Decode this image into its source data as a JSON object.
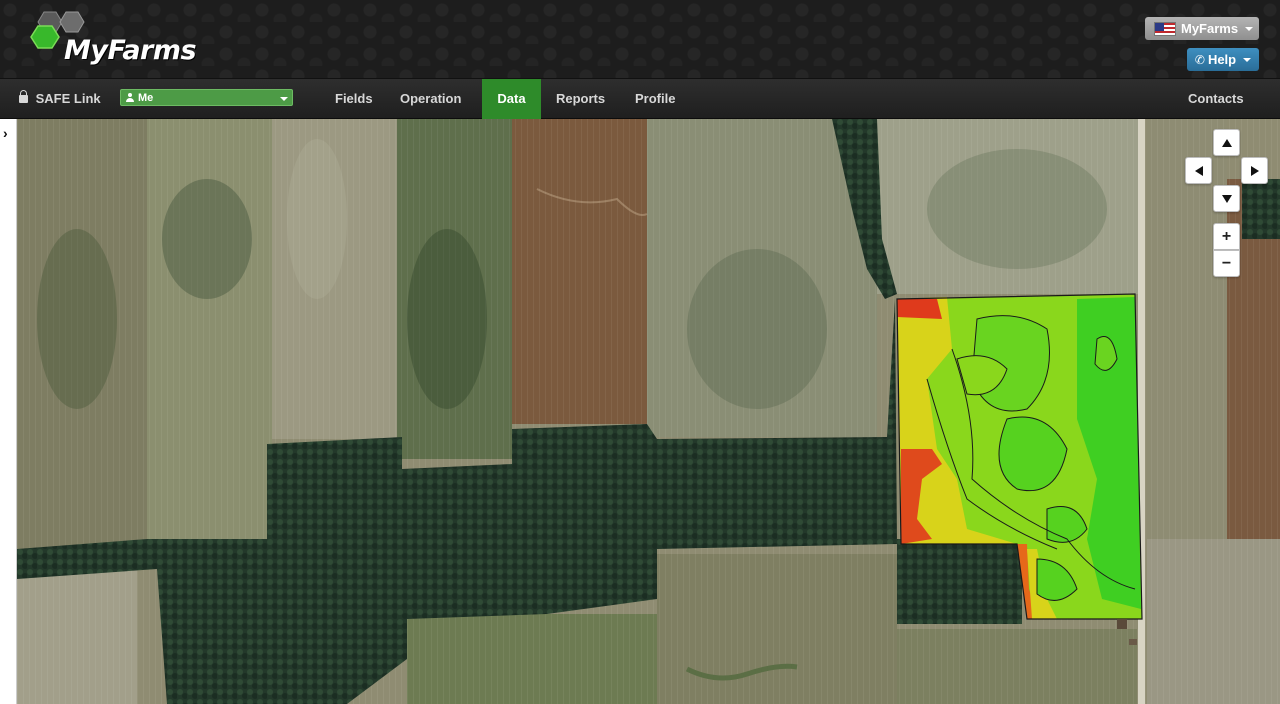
{
  "app": {
    "brand": "MyFarms"
  },
  "header": {
    "farm_selector": {
      "label": "MyFarms",
      "flag_icon": "us-flag-icon"
    },
    "help": {
      "label": "Help",
      "icon": "phone-icon"
    }
  },
  "nav": {
    "safe_link": {
      "label": "SAFE Link",
      "icon": "lock-icon"
    },
    "user_selector": {
      "label": "Me",
      "icon": "user-icon"
    },
    "items": [
      {
        "label": "Fields",
        "active": false
      },
      {
        "label": "Operation",
        "active": false
      },
      {
        "label": "Data",
        "active": true
      },
      {
        "label": "Reports",
        "active": false
      },
      {
        "label": "Profile",
        "active": false
      }
    ],
    "contacts": {
      "label": "Contacts"
    }
  },
  "map_controls": {
    "zoom_in": "+",
    "zoom_out": "−"
  },
  "colors": {
    "active_nav": "#2e8b2a",
    "help_button": "#337ab7",
    "user_selector": "#4d9b46",
    "zone_high": "#3bcf1f",
    "zone_mid": "#8fdc1a",
    "zone_low": "#e7d117",
    "zone_lowest": "#e2341d"
  }
}
